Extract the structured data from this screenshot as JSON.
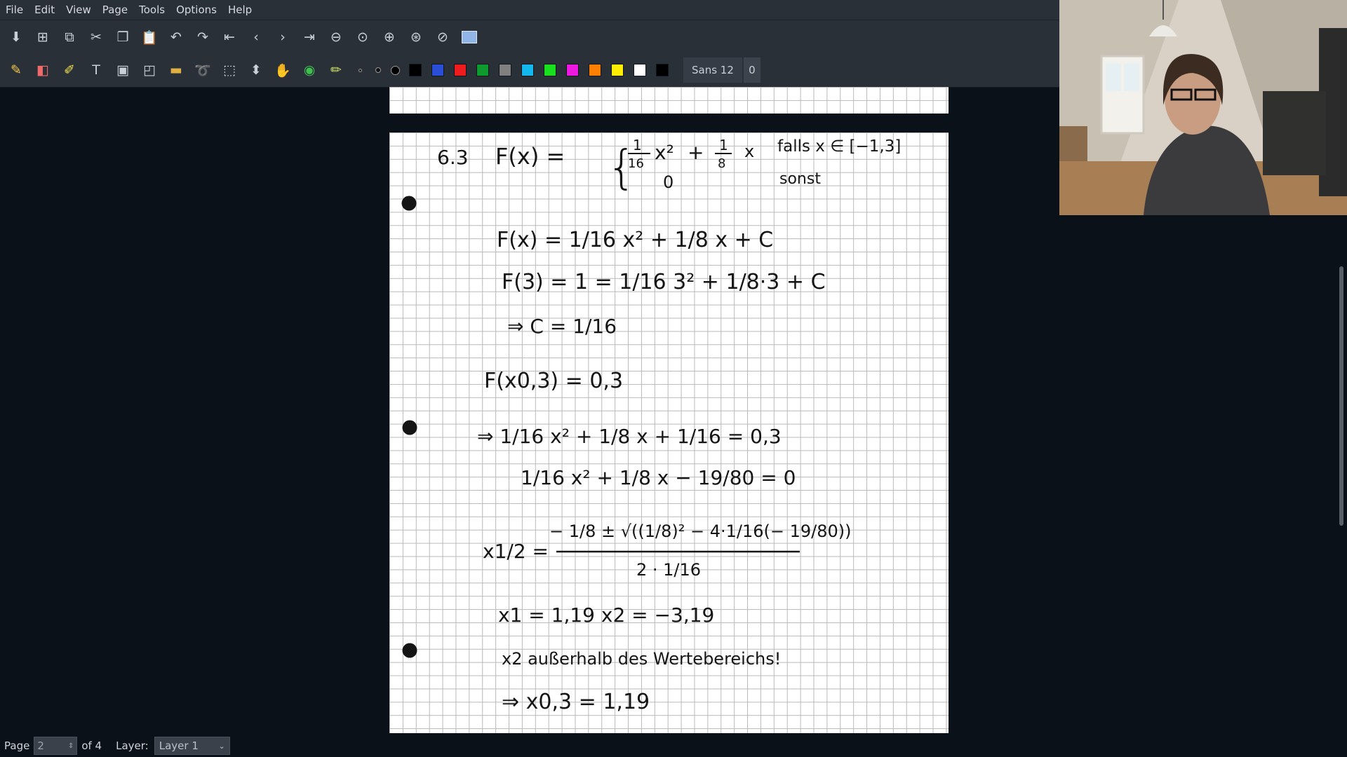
{
  "menu": [
    "File",
    "Edit",
    "View",
    "Page",
    "Tools",
    "Options",
    "Help"
  ],
  "toolbar1_icons": [
    "save-icon",
    "new-page-icon",
    "copy-page-icon",
    "cut-icon",
    "copy-icon",
    "paste-icon",
    "undo-icon",
    "redo-icon",
    "first-page-icon",
    "prev-page-icon",
    "next-page-icon",
    "last-page-icon",
    "zoom-out-icon",
    "zoom-fit-icon",
    "zoom-in-icon",
    "zoom-100-icon",
    "zoom-width-icon",
    "fullscreen-icon"
  ],
  "toolbar2_tools": [
    "pen-icon",
    "eraser-icon",
    "highlighter-icon",
    "text-icon",
    "image-icon",
    "shape-icon",
    "ruler-icon",
    "lasso-icon",
    "rect-select-icon",
    "vertical-space-icon",
    "hand-icon",
    "shape-recognizer-icon",
    "default-tool-icon"
  ],
  "colors": [
    "#000000",
    "#2a4fd6",
    "#ee1c1c",
    "#0f9a30",
    "#808080",
    "#12b8ee",
    "#19e01f",
    "#ee19e0",
    "#ff8000",
    "#ffee00",
    "#ffffff",
    "#000000"
  ],
  "font": {
    "label": "Sans 12",
    "size": "0"
  },
  "status": {
    "page_label": "Page",
    "page_value": "2",
    "of_label": "of 4",
    "layer_label": "Layer:",
    "layer_value": "Layer 1"
  },
  "notes": {
    "l1_num": "6.3",
    "l1_lhs": "F(x) =",
    "l1_a": "1",
    "l1_a_den": "16",
    "l1_x2": "x²",
    "l1_plus": "+",
    "l1_b": "1",
    "l1_b_den": "8",
    "l1_x": "x",
    "l1_cond1": "falls x ∈ [−1,3]",
    "l1_zero": "0",
    "l1_cond2": "sonst",
    "l2": "F(x) = 1/16 x² + 1/8 x + C",
    "l3": "F(3) = 1 = 1/16 3² + 1/8·3 + C",
    "l4": "⇒ C = 1/16",
    "l5": "F(x0,3) = 0,3",
    "l6": "⇒ 1/16 x² + 1/8 x + 1/16 = 0,3",
    "l7": "1/16 x² + 1/8 x − 19/80 = 0",
    "l8_lhs": "x1/2 =",
    "l8_num": "− 1/8 ± √((1/8)² − 4·1/16(− 19/80))",
    "l8_den": "2 · 1/16",
    "l9": "x1 = 1,19    x2 = −3,19",
    "l10": "x2 außerhalb des Wertebereichs!",
    "l11": "⇒ x0,3 = 1,19"
  }
}
